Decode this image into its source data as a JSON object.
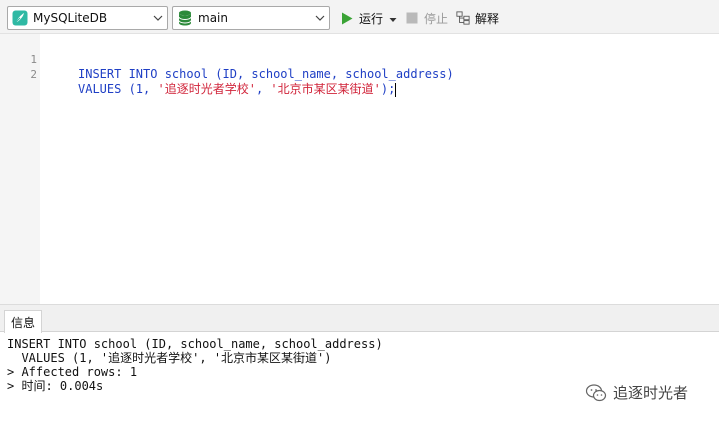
{
  "toolbar": {
    "connection": {
      "value": "MySQLiteDB",
      "icon": "sqlite-feather-icon"
    },
    "database": {
      "value": "main",
      "icon": "database-icon"
    },
    "run_label": "运行",
    "stop_label": "停止",
    "explain_label": "解释"
  },
  "editor": {
    "lines": [
      {
        "num": "1",
        "text": "INSERT INTO school (ID, school_name, school_address)"
      },
      {
        "num": "2",
        "prefix": "VALUES (1, ",
        "str1": "'追逐时光者学校'",
        "sep": ", ",
        "str2": "'北京市某区某街道'",
        "suffix": ");"
      }
    ]
  },
  "info_panel": {
    "tab_label": "信息",
    "output": [
      "INSERT INTO school (ID, school_name, school_address)",
      "  VALUES (1, '追逐时光者学校', '北京市某区某街道')",
      "> Affected rows: 1",
      "> 时间: 0.004s"
    ]
  },
  "watermark": {
    "text": "追逐时光者",
    "icon": "wechat-icon"
  },
  "colors": {
    "keyword": "#1f3fc5",
    "string": "#d1243a",
    "run_green": "#3aa335",
    "db_green": "#2c8a3a"
  }
}
